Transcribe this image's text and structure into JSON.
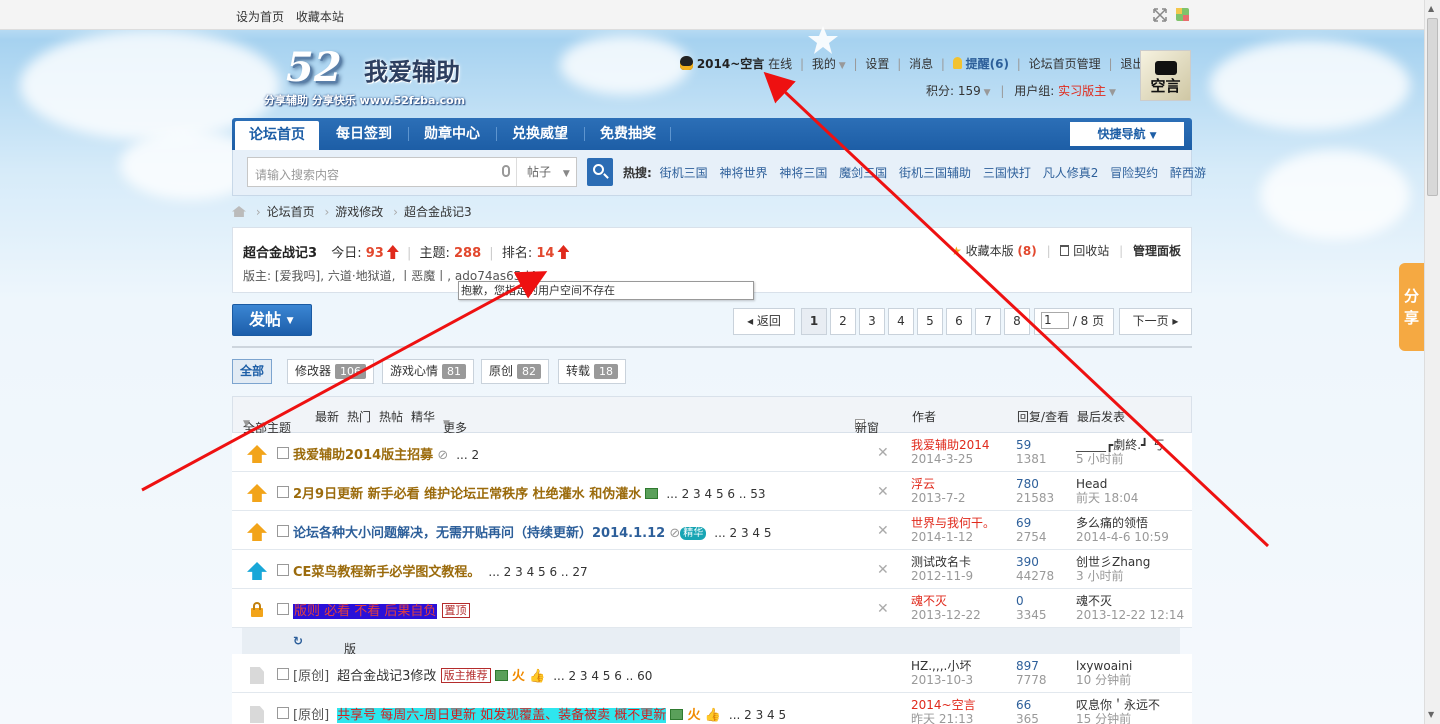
{
  "topbar": {
    "set_home": "设为首页",
    "bookmark": "收藏本站"
  },
  "logo": {
    "num": "52",
    "name": "我爱辅助",
    "sub": "分享辅助  分享快乐  www.52fzba.com"
  },
  "user": {
    "name": "2014~空言",
    "status": "在线",
    "my": "我的",
    "settings": "设置",
    "messages": "消息",
    "remind": "提醒(6)",
    "admin": "论坛首页管理",
    "logout": "退出",
    "points_label": "积分: 159",
    "group_label": "用户组:",
    "group": "实习版主",
    "avatar_text": "空言"
  },
  "nav": {
    "items": [
      "论坛首页",
      "每日签到",
      "勋章中心",
      "兑换威望",
      "免费抽奖"
    ],
    "quick": "快捷导航"
  },
  "search": {
    "placeholder": "请输入搜索内容",
    "type": "帖子",
    "hot_label": "热搜:",
    "hot": [
      "街机三国",
      "神将世界",
      "神将三国",
      "魔剑三国",
      "街机三国辅助",
      "三国快打",
      "凡人修真2",
      "冒险契约",
      "醉西游"
    ]
  },
  "breadcrumb": [
    "论坛首页",
    "游戏修改",
    "超合金战记3"
  ],
  "forum": {
    "name": "超合金战记3",
    "today_label": "今日:",
    "today": "93",
    "topics_label": "主题:",
    "topics": "288",
    "rank_label": "排名:",
    "rank": "14",
    "mods": "版主: [爱我吗], 六道·地狱道, 丨恶魔丨, ado74as65d4",
    "fav": "收藏本版",
    "fav_count": "(8)",
    "recycle": "回收站",
    "panel": "管理面板"
  },
  "tooltip": "抱歉，您指定的用户空间不存在",
  "post_button": "发帖",
  "pager": {
    "back": "返回",
    "pages": [
      "1",
      "2",
      "3",
      "4",
      "5",
      "6",
      "7",
      "8"
    ],
    "input": "1",
    "total": "/ 8 页",
    "next": "下一页"
  },
  "tabs": [
    {
      "label": "全部",
      "count": ""
    },
    {
      "label": "修改器",
      "count": "106"
    },
    {
      "label": "游戏心情",
      "count": "81"
    },
    {
      "label": "原创",
      "count": "82"
    },
    {
      "label": "转载",
      "count": "18"
    }
  ],
  "list_head": {
    "all": "全部主题",
    "latest": "最新",
    "hot": "热门",
    "hotpost": "热帖",
    "digest": "精华",
    "more": "更多",
    "newwin": "新窗",
    "author": "作者",
    "replies": "回复/查看",
    "lastpost": "最后发表"
  },
  "threads": [
    {
      "title": "我爱辅助2014版主招募",
      "pages": "... 2",
      "author": "我爱辅助2014",
      "date": "2014-3-25",
      "replies": "59",
      "views": "1381",
      "last_user": "_____┏劇終.┛ 丂",
      "last_time": "5 小时前"
    },
    {
      "title": "2月9日更新 新手必看 维护论坛正常秩序 杜绝灌水 和伪灌水",
      "pages": "... 2 3 4 5 6 .. 53",
      "author": "浮云",
      "date": "2013-7-2",
      "replies": "780",
      "views": "21583",
      "last_user": "Head",
      "last_time": "前天 18:04"
    },
    {
      "title": "论坛各种大小问题解决，无需开贴再问（持续更新）2014.1.12",
      "jing": "精华",
      "pages": "... 2 3 4 5",
      "author": "世界与我何干。",
      "date": "2014-1-12",
      "replies": "69",
      "views": "2754",
      "last_user": "多么痛的领悟",
      "last_time": "2014-4-6 10:59"
    },
    {
      "title": "CE菜鸟教程新手必学图文教程。",
      "pages": "... 2 3 4 5 6 .. 27",
      "author": "测试改名卡",
      "date": "2012-11-9",
      "replies": "390",
      "views": "44278",
      "last_user": "创世彡Zhang",
      "last_time": "3 小时前"
    },
    {
      "title": "版则 必看 不看 后果自负",
      "tag": "置顶",
      "author": "魂不灭",
      "date": "2013-12-22",
      "replies": "0",
      "views": "3345",
      "last_user": "魂不灭",
      "last_time": "2013-12-22 12:14"
    },
    {
      "prefix": "[原创]",
      "title": "超合金战记3修改",
      "tag": "版主推荐",
      "pages": "... 2 3 4 5 6 .. 60",
      "author": "HZ.,,,.小坏",
      "date": "2013-10-3",
      "replies": "897",
      "views": "7778",
      "last_user": "lxywoaini",
      "last_time": "10 分钟前"
    },
    {
      "prefix": "[原创]",
      "title": "共享号 每周六-周日更新 如发现覆盖、装备被卖 概不更新",
      "pages": "... 2 3 4 5",
      "author": "2014~空言",
      "date": "昨天 21:13",
      "replies": "66",
      "views": "365",
      "last_user": "叹息你＇永远不",
      "last_time": "15 分钟前"
    }
  ],
  "sub_head": "版块主题",
  "share": "分享",
  "colors": {
    "nav": "#1d5ea6",
    "accent_red": "#e2482e",
    "gold_title": "#9b6b0c",
    "blue_title": "#2d5f9a"
  }
}
